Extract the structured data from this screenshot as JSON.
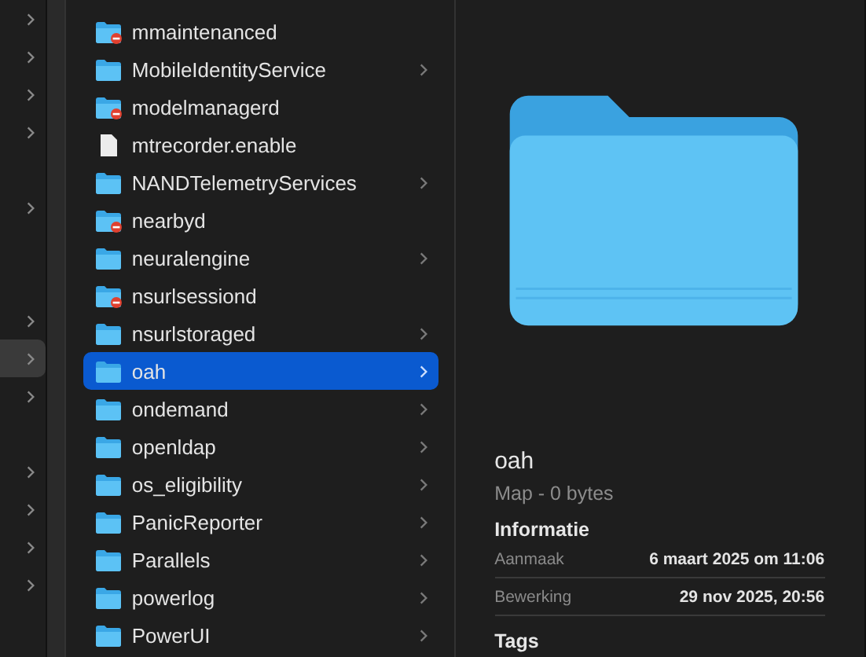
{
  "sidebar": {
    "items": [
      {
        "chevron": true,
        "selected": false
      },
      {
        "chevron": true,
        "selected": false
      },
      {
        "chevron": true,
        "selected": false
      },
      {
        "chevron": true,
        "selected": false
      },
      {
        "chevron": false,
        "selected": false
      },
      {
        "chevron": true,
        "selected": false
      },
      {
        "chevron": false,
        "selected": false
      },
      {
        "chevron": false,
        "selected": false
      },
      {
        "chevron": true,
        "selected": false
      },
      {
        "chevron": true,
        "selected": true
      },
      {
        "chevron": true,
        "selected": false
      },
      {
        "chevron": false,
        "selected": false
      },
      {
        "chevron": true,
        "selected": false
      },
      {
        "chevron": true,
        "selected": false
      },
      {
        "chevron": true,
        "selected": false
      },
      {
        "chevron": true,
        "selected": false
      }
    ]
  },
  "files": [
    {
      "name": "mmaintenanced",
      "kind": "restricted",
      "chevron": false,
      "selected": false
    },
    {
      "name": "MobileIdentityService",
      "kind": "folder",
      "chevron": true,
      "selected": false
    },
    {
      "name": "modelmanagerd",
      "kind": "restricted",
      "chevron": false,
      "selected": false
    },
    {
      "name": "mtrecorder.enable",
      "kind": "file",
      "chevron": false,
      "selected": false
    },
    {
      "name": "NANDTelemetryServices",
      "kind": "folder",
      "chevron": true,
      "selected": false
    },
    {
      "name": "nearbyd",
      "kind": "restricted",
      "chevron": false,
      "selected": false
    },
    {
      "name": "neuralengine",
      "kind": "folder",
      "chevron": true,
      "selected": false
    },
    {
      "name": "nsurlsessiond",
      "kind": "restricted",
      "chevron": false,
      "selected": false
    },
    {
      "name": "nsurlstoraged",
      "kind": "folder",
      "chevron": true,
      "selected": false
    },
    {
      "name": "oah",
      "kind": "folder",
      "chevron": true,
      "selected": true
    },
    {
      "name": "ondemand",
      "kind": "folder",
      "chevron": true,
      "selected": false
    },
    {
      "name": "openldap",
      "kind": "folder",
      "chevron": true,
      "selected": false
    },
    {
      "name": "os_eligibility",
      "kind": "folder",
      "chevron": true,
      "selected": false
    },
    {
      "name": "PanicReporter",
      "kind": "folder",
      "chevron": true,
      "selected": false
    },
    {
      "name": "Parallels",
      "kind": "folder",
      "chevron": true,
      "selected": false
    },
    {
      "name": "powerlog",
      "kind": "folder",
      "chevron": true,
      "selected": false
    },
    {
      "name": "PowerUI",
      "kind": "folder",
      "chevron": true,
      "selected": false
    }
  ],
  "preview": {
    "name": "oah",
    "subtitle": "Map - 0 bytes",
    "section": "Informatie",
    "info": [
      {
        "label": "Aanmaak",
        "value": "6 maart 2025 om 11:06"
      },
      {
        "label": "Bewerking",
        "value": "29 nov 2025, 20:56"
      }
    ],
    "tags": "Tags"
  }
}
